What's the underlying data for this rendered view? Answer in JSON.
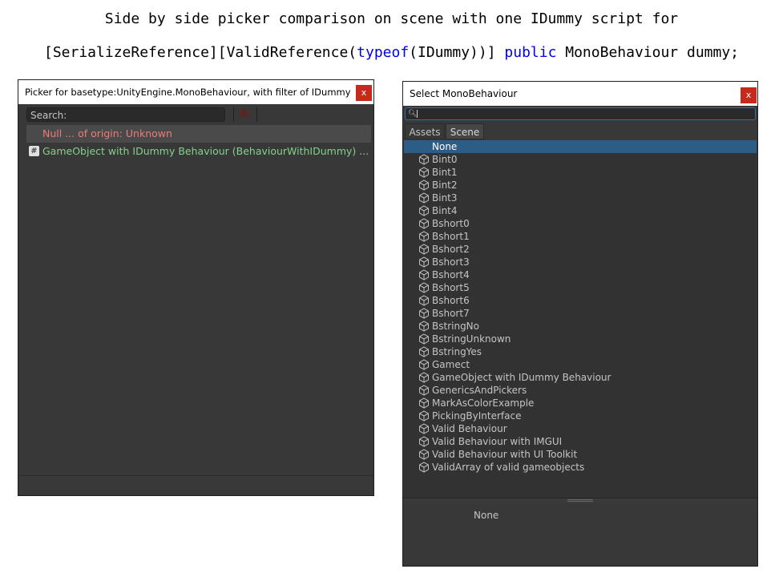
{
  "caption": {
    "line1": "Side by side picker comparison on scene with one IDummy script for",
    "line2_a": "[SerializeReference][ValidReference(",
    "line2_kw1": "typeof",
    "line2_b": "(IDummy))] ",
    "line2_kw2": "public",
    "line2_c": " MonoBehaviour dummy;"
  },
  "left_window": {
    "title": "Picker for basetype:UnityEngine.MonoBehaviour, with filter of IDummy",
    "close_label": "x",
    "search_placeholder": "Search:",
    "match_case_label": "A:",
    "rows": [
      {
        "text": "Null ... of origin: Unknown"
      },
      {
        "icon_text": "#",
        "text": "GameObject with IDummy Behaviour (BehaviourWithIDummy) ... of origin"
      }
    ]
  },
  "right_window": {
    "title": "Select MonoBehaviour",
    "close_label": "x",
    "tabs": [
      "Assets",
      "Scene"
    ],
    "selected_tab": "Scene",
    "items": [
      "None",
      "Bint0",
      "Bint1",
      "Bint2",
      "Bint3",
      "Bint4",
      "Bshort0",
      "Bshort1",
      "Bshort2",
      "Bshort3",
      "Bshort4",
      "Bshort5",
      "Bshort6",
      "Bshort7",
      "BstringNo",
      "BstringUnknown",
      "BstringYes",
      "Gamect",
      "GameObject with IDummy Behaviour",
      "GenericsAndPickers",
      "MarkAsColorExample",
      "PickingByInterface",
      "Valid Behaviour",
      "Valid Behaviour with IMGUI",
      "Valid Behaviour with UI Toolkit",
      "ValidArray of valid gameobjects"
    ],
    "selected_item": "None",
    "item_icon": "gameobject-cube-icon",
    "preview_label": "None"
  },
  "colors": {
    "null_row_text": "#ee7b7b",
    "match_row_text": "#83d18a",
    "selection": "#2c5d87",
    "close_button": "#c42b1c",
    "keyword": "#0000ee"
  }
}
